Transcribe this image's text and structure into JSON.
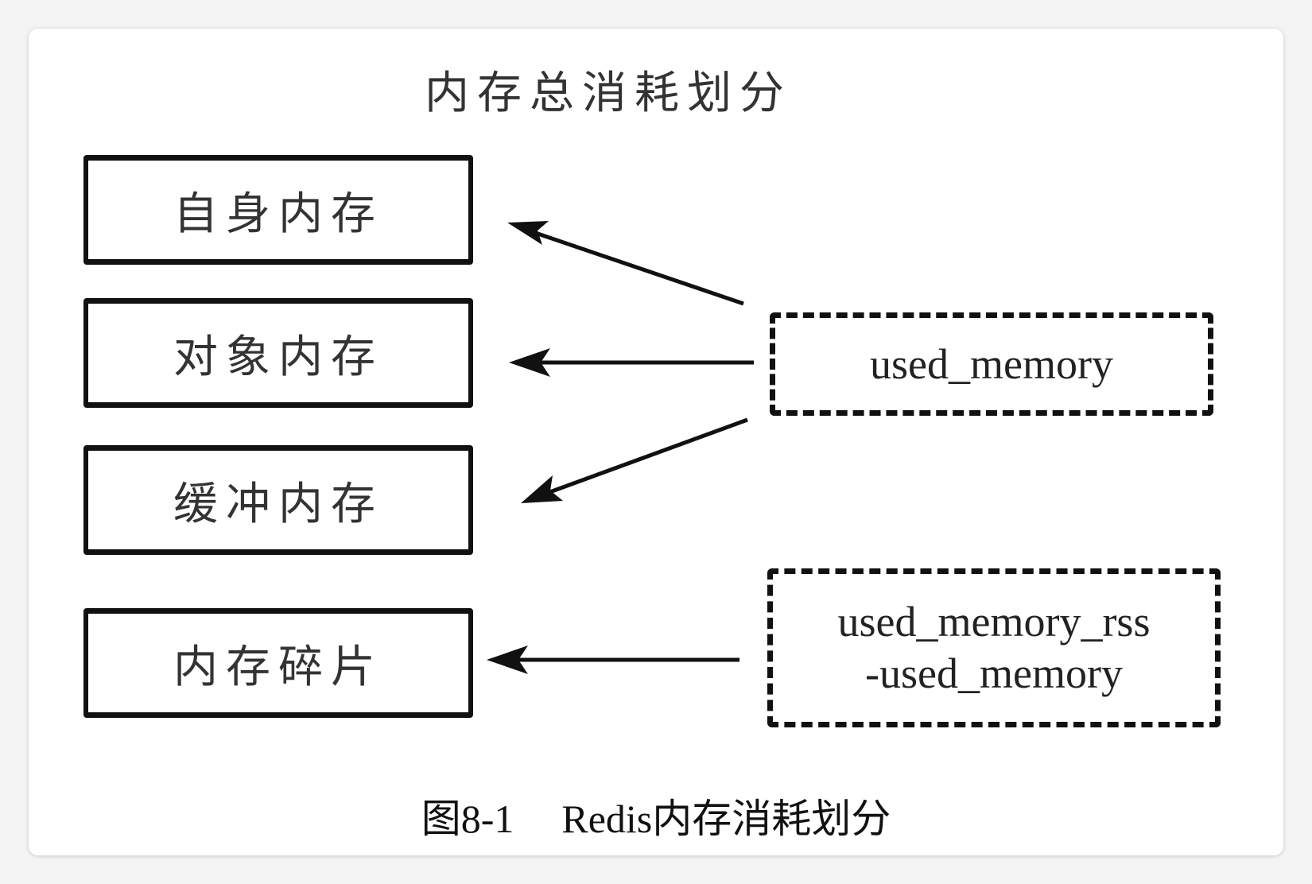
{
  "diagram": {
    "title": "内存总消耗划分",
    "left_boxes": [
      {
        "label": "自身内存"
      },
      {
        "label": "对象内存"
      },
      {
        "label": "缓冲内存"
      },
      {
        "label": "内存碎片"
      }
    ],
    "right_boxes": [
      {
        "line1": "used_memory",
        "line2": ""
      },
      {
        "line1": "used_memory_rss",
        "line2": "-used_memory"
      }
    ]
  },
  "caption": {
    "number": "图8-1",
    "text": "Redis内存消耗划分"
  }
}
